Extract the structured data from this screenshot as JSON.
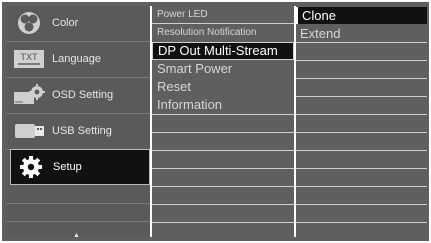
{
  "sidebar": {
    "items": [
      {
        "label": "Color",
        "icon": "color-circles-icon"
      },
      {
        "label": "Language",
        "icon": "txt-keyboard-icon"
      },
      {
        "label": "OSD Setting",
        "icon": "osd-gear-icon"
      },
      {
        "label": "USB Setting",
        "icon": "usb-connector-icon"
      },
      {
        "label": "Setup",
        "icon": "gear-icon"
      }
    ],
    "selected": "Setup",
    "scroll_up_glyph": "▲"
  },
  "submenu": {
    "items": [
      {
        "label": "Power LED"
      },
      {
        "label": "Resolution Notification"
      },
      {
        "label": "DP Out Multi-Stream"
      },
      {
        "label": "Smart Power"
      },
      {
        "label": "Reset"
      },
      {
        "label": "Information"
      }
    ],
    "selected": "DP Out Multi-Stream"
  },
  "options": {
    "items": [
      {
        "label": "Clone"
      },
      {
        "label": "Extend"
      }
    ],
    "selected": "Clone"
  },
  "colors": {
    "background": "#5f5f5f",
    "highlight": "#111111",
    "text": "#d6d6d6",
    "gridline": "#cfcfcf"
  }
}
